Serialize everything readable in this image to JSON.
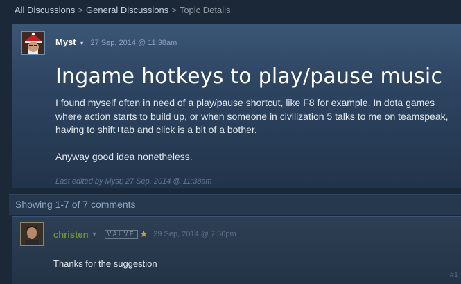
{
  "breadcrumbs": {
    "items": [
      "All Discussions",
      "General Discussions"
    ],
    "current": "Topic Details",
    "separator": ">"
  },
  "topic": {
    "author": "Myst",
    "date": "27 Sep, 2014 @ 11:38am",
    "title": "Ingame hotkeys to play/pause music",
    "paragraphs": [
      "I found myself often in need of a play/pause shortcut, like F8 for example. In dota games where action starts to build up, or when someone in civilization 5 talks to me on teamspeak, having to shift+tab and click is a bit of a bother.",
      "Anyway good idea nonetheless."
    ],
    "edited": "Last edited by Myst; 27 Sep, 2014 @ 11:38am"
  },
  "comments_summary": "Showing 1-7 of 7 comments",
  "comment": {
    "author": "christen",
    "badge": "VALVE",
    "date": "29 Sep, 2014 @ 7:50pm",
    "text": "Thanks for the suggestion",
    "index": "#1"
  },
  "icons": {
    "caret": "chevron-down-icon",
    "star": "star-icon"
  },
  "colors": {
    "background": "#1b2838",
    "valve_author": "#6f8f3c",
    "star": "#c9a23a"
  }
}
